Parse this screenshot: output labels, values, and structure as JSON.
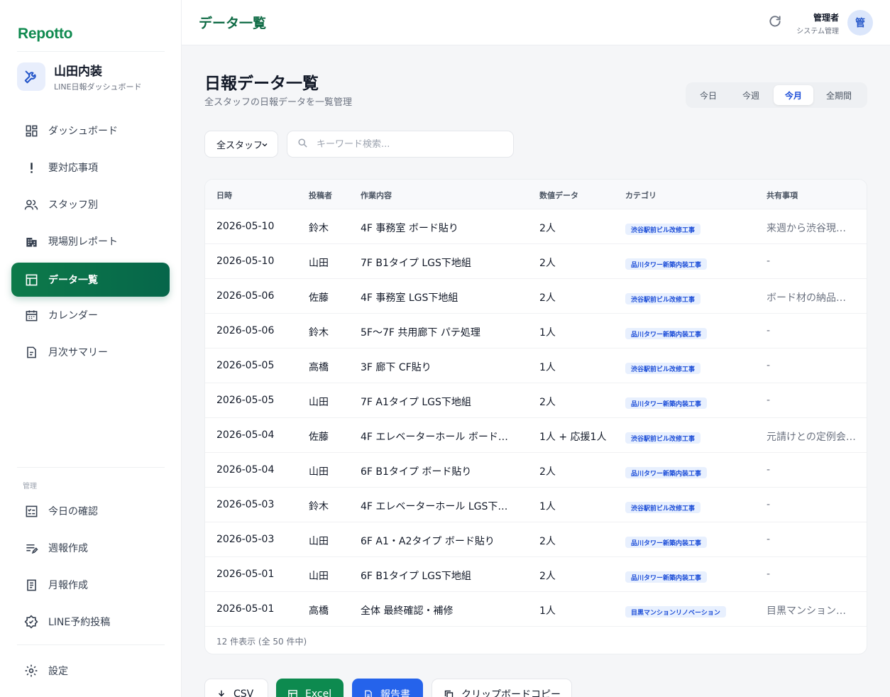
{
  "app": {
    "logo": "Repotto"
  },
  "company": {
    "name": "山田内装",
    "subtitle": "LINE日報ダッシュボード"
  },
  "nav": {
    "items": [
      {
        "label": "ダッシュボード",
        "icon": "dashboard-grid-icon"
      },
      {
        "label": "要対応事項",
        "icon": "exclamation-icon"
      },
      {
        "label": "スタッフ別",
        "icon": "users-icon"
      },
      {
        "label": "現場別レポート",
        "icon": "building-icon"
      },
      {
        "label": "データ一覧",
        "icon": "table-icon",
        "active": true
      },
      {
        "label": "カレンダー",
        "icon": "calendar-icon"
      },
      {
        "label": "月次サマリー",
        "icon": "document-icon"
      }
    ],
    "section_label": "管理",
    "admin_items": [
      {
        "label": "今日の確認",
        "icon": "checklist-icon"
      },
      {
        "label": "週報作成",
        "icon": "edit-list-icon"
      },
      {
        "label": "月報作成",
        "icon": "report-icon"
      },
      {
        "label": "LINE予約投稿",
        "icon": "schedule-icon"
      }
    ],
    "settings": {
      "label": "設定",
      "icon": "gear-icon"
    }
  },
  "topbar": {
    "title": "データ一覧",
    "user_name": "管理者",
    "user_role": "システム管理",
    "avatar": "管"
  },
  "page": {
    "title": "日報データ一覧",
    "subtitle": "全スタッフの日報データを一覧管理"
  },
  "period": {
    "options": [
      "今日",
      "今週",
      "今月",
      "全期間"
    ],
    "selected": "今月"
  },
  "filters": {
    "staff": "全スタッフ",
    "search_placeholder": "キーワード検索..."
  },
  "table": {
    "columns": [
      "日時",
      "投稿者",
      "作業内容",
      "数値データ",
      "カテゴリ",
      "共有事項"
    ],
    "rows": [
      {
        "date": "2026-05-10",
        "author": "鈴木",
        "work": "4F 事務室 ボード貼り",
        "count": "2人",
        "category": "渋谷駅前ビル改修工事",
        "note": "来週から渋谷現…"
      },
      {
        "date": "2026-05-10",
        "author": "山田",
        "work": "7F B1タイプ LGS下地組",
        "count": "2人",
        "category": "品川タワー新築内装工事",
        "note": "-"
      },
      {
        "date": "2026-05-06",
        "author": "佐藤",
        "work": "4F 事務室 LGS下地組",
        "count": "2人",
        "category": "渋谷駅前ビル改修工事",
        "note": "ボード材の納品…"
      },
      {
        "date": "2026-05-06",
        "author": "鈴木",
        "work": "5F〜7F 共用廊下 パテ処理",
        "count": "1人",
        "category": "品川タワー新築内装工事",
        "note": "-"
      },
      {
        "date": "2026-05-05",
        "author": "高橋",
        "work": "3F 廊下 CF貼り",
        "count": "1人",
        "category": "渋谷駅前ビル改修工事",
        "note": "-"
      },
      {
        "date": "2026-05-05",
        "author": "山田",
        "work": "7F A1タイプ LGS下地組",
        "count": "2人",
        "category": "品川タワー新築内装工事",
        "note": "-"
      },
      {
        "date": "2026-05-04",
        "author": "佐藤",
        "work": "4F エレベーターホール ボード…",
        "count": "1人 + 応援1人",
        "category": "渋谷駅前ビル改修工事",
        "note": "元請けとの定例会…"
      },
      {
        "date": "2026-05-04",
        "author": "山田",
        "work": "6F B1タイプ ボード貼り",
        "count": "2人",
        "category": "品川タワー新築内装工事",
        "note": "-"
      },
      {
        "date": "2026-05-03",
        "author": "鈴木",
        "work": "4F エレベーターホール LGS下…",
        "count": "1人",
        "category": "渋谷駅前ビル改修工事",
        "note": "-"
      },
      {
        "date": "2026-05-03",
        "author": "山田",
        "work": "6F A1・A2タイプ ボード貼り",
        "count": "2人",
        "category": "品川タワー新築内装工事",
        "note": "-"
      },
      {
        "date": "2026-05-01",
        "author": "山田",
        "work": "6F B1タイプ LGS下地組",
        "count": "2人",
        "category": "品川タワー新築内装工事",
        "note": "-"
      },
      {
        "date": "2026-05-01",
        "author": "高橋",
        "work": "全体 最終確認・補修",
        "count": "1人",
        "category": "目黒マンションリノベーション",
        "note": "目黒マンション…"
      }
    ],
    "footer": "12 件表示 (全 50 件中)"
  },
  "actions": {
    "csv": "CSV",
    "excel": "Excel",
    "report": "報告書",
    "clipboard": "クリップボードコピー"
  },
  "colors": {
    "brand_green": "#0d7a4a",
    "accent_blue": "#2563eb",
    "badge_bg": "#e8f0fe"
  }
}
